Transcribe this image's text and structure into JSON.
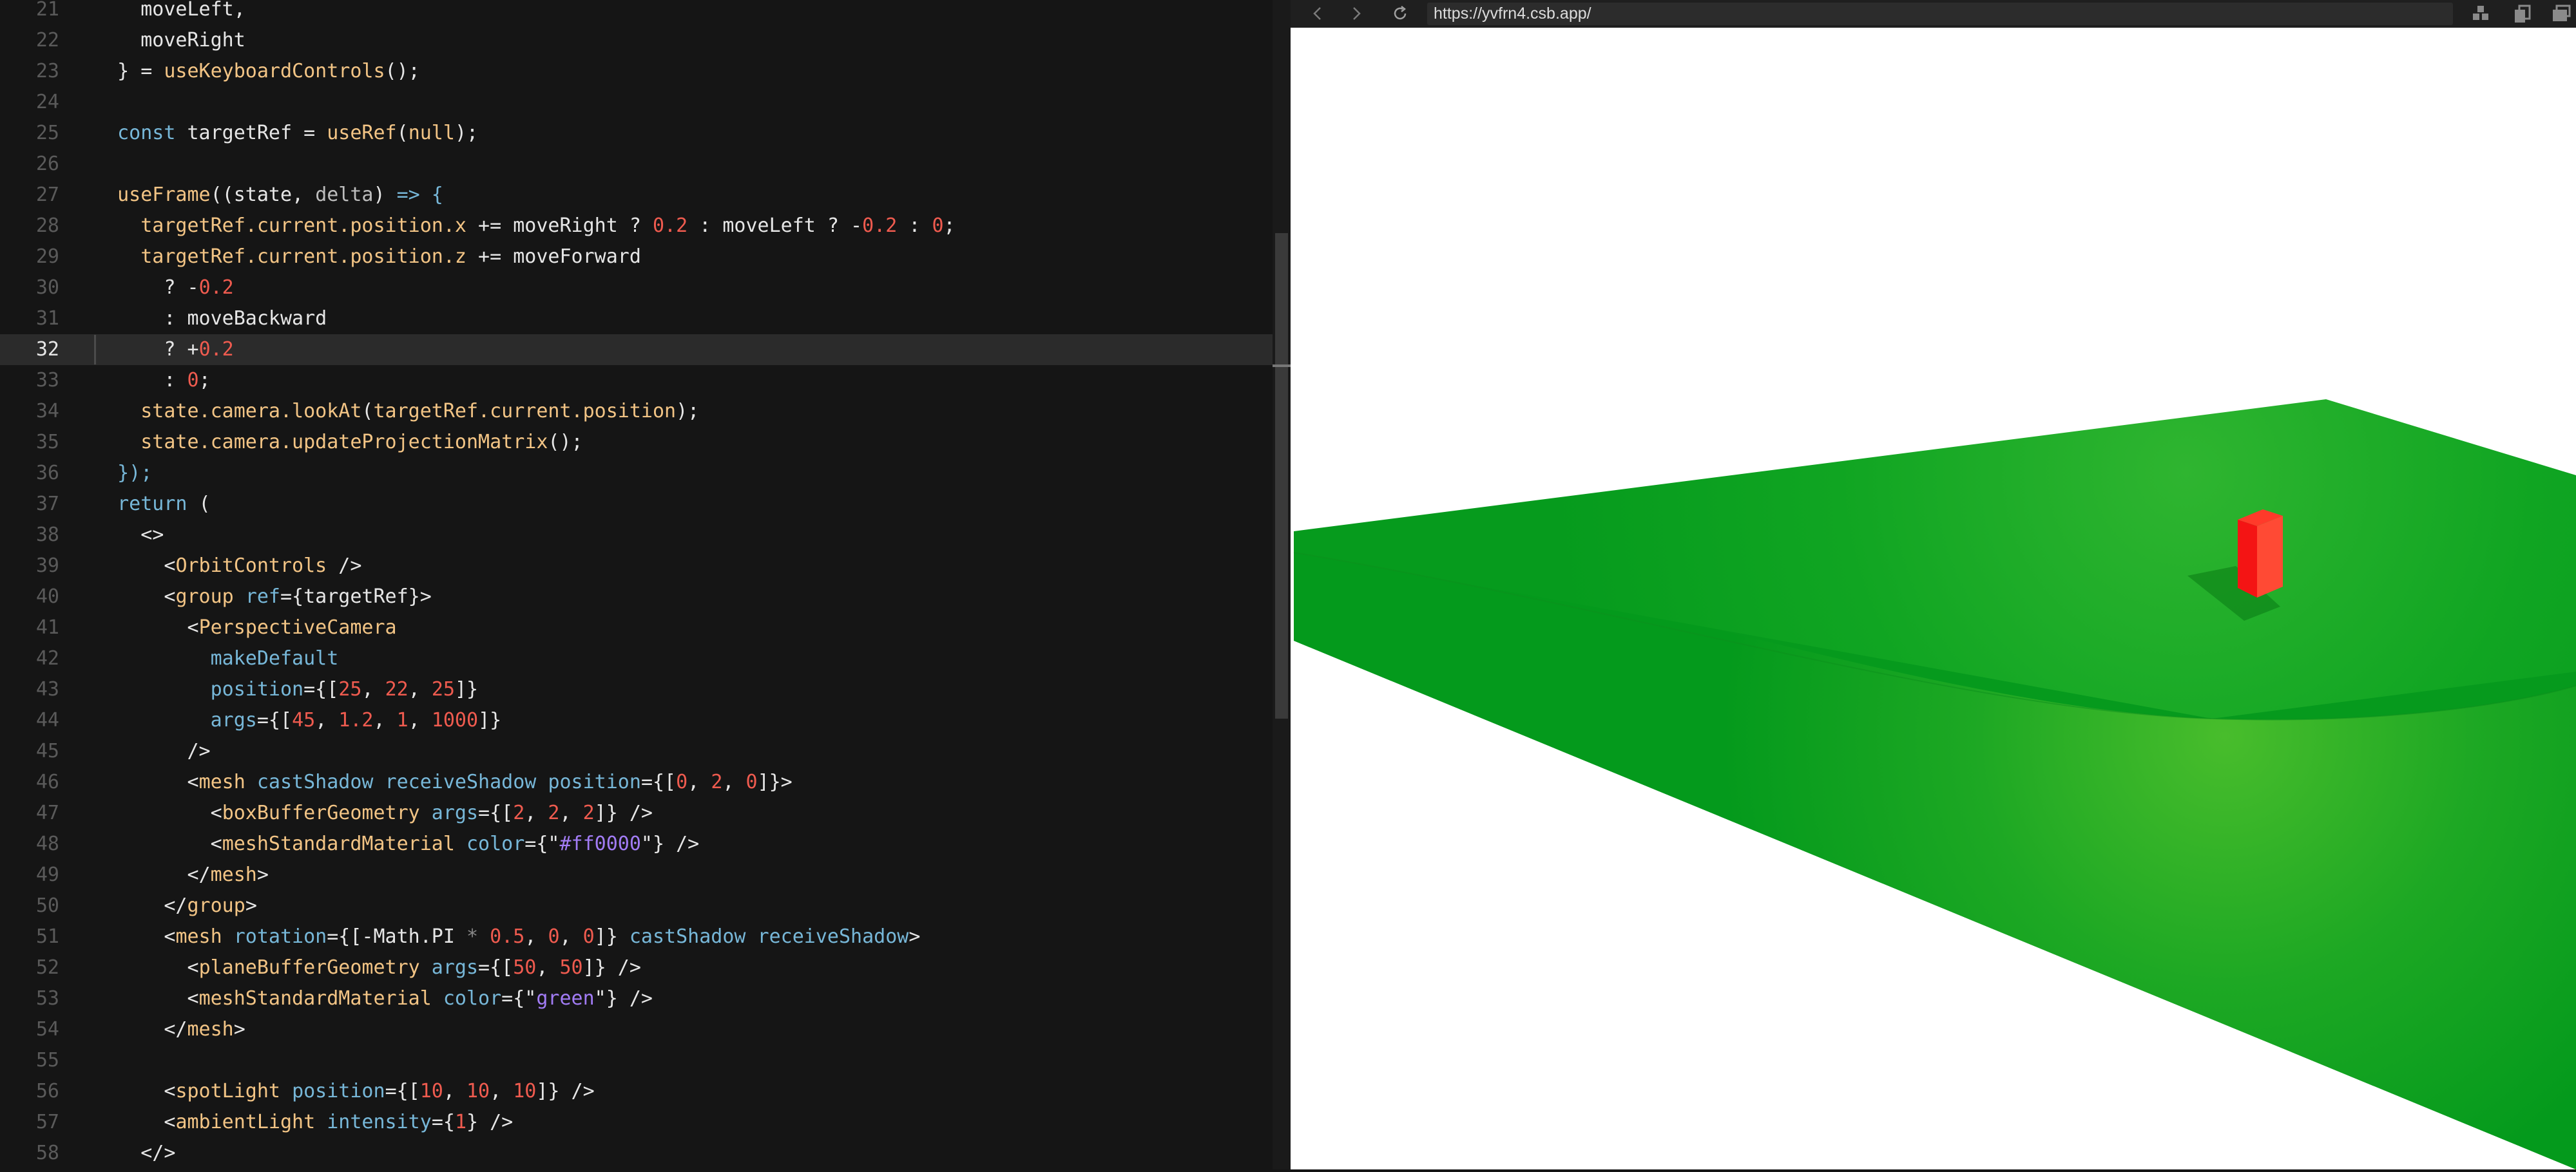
{
  "editor": {
    "current_line": 32,
    "lines": [
      {
        "num": 21,
        "tokens": [
          {
            "t": "    moveLeft,",
            "c": "default"
          }
        ]
      },
      {
        "num": 22,
        "tokens": [
          {
            "t": "    moveRight",
            "c": "default"
          }
        ]
      },
      {
        "num": 23,
        "tokens": [
          {
            "t": "  } = ",
            "c": "default"
          },
          {
            "t": "useKeyboardControls",
            "c": "function"
          },
          {
            "t": "();",
            "c": "default"
          }
        ]
      },
      {
        "num": 24,
        "tokens": []
      },
      {
        "num": 25,
        "tokens": [
          {
            "t": "  ",
            "c": "default"
          },
          {
            "t": "const",
            "c": "keyword"
          },
          {
            "t": " targetRef = ",
            "c": "default"
          },
          {
            "t": "useRef",
            "c": "function"
          },
          {
            "t": "(",
            "c": "default"
          },
          {
            "t": "null",
            "c": "function"
          },
          {
            "t": ");",
            "c": "default"
          }
        ]
      },
      {
        "num": 26,
        "tokens": []
      },
      {
        "num": 27,
        "tokens": [
          {
            "t": "  ",
            "c": "default"
          },
          {
            "t": "useFrame",
            "c": "function"
          },
          {
            "t": "((state, ",
            "c": "default"
          },
          {
            "t": "delta",
            "c": "param"
          },
          {
            "t": ") ",
            "c": "default"
          },
          {
            "t": "=> {",
            "c": "keyword"
          }
        ]
      },
      {
        "num": 28,
        "tokens": [
          {
            "t": "    ",
            "c": "default"
          },
          {
            "t": "targetRef.current.position.x",
            "c": "function"
          },
          {
            "t": " += moveRight ? ",
            "c": "default"
          },
          {
            "t": "0.2",
            "c": "number"
          },
          {
            "t": " : moveLeft ? -",
            "c": "default"
          },
          {
            "t": "0.2",
            "c": "number"
          },
          {
            "t": " : ",
            "c": "default"
          },
          {
            "t": "0",
            "c": "number"
          },
          {
            "t": ";",
            "c": "default"
          }
        ]
      },
      {
        "num": 29,
        "tokens": [
          {
            "t": "    ",
            "c": "default"
          },
          {
            "t": "targetRef.current.position.z",
            "c": "function"
          },
          {
            "t": " += moveForward",
            "c": "default"
          }
        ]
      },
      {
        "num": 30,
        "tokens": [
          {
            "t": "      ? -",
            "c": "default"
          },
          {
            "t": "0.2",
            "c": "number"
          }
        ]
      },
      {
        "num": 31,
        "tokens": [
          {
            "t": "      : moveBackward",
            "c": "default"
          }
        ]
      },
      {
        "num": 32,
        "tokens": [
          {
            "t": "      ? +",
            "c": "default"
          },
          {
            "t": "0.2",
            "c": "number"
          }
        ]
      },
      {
        "num": 33,
        "tokens": [
          {
            "t": "      : ",
            "c": "default"
          },
          {
            "t": "0",
            "c": "number"
          },
          {
            "t": ";",
            "c": "default"
          }
        ]
      },
      {
        "num": 34,
        "tokens": [
          {
            "t": "    ",
            "c": "default"
          },
          {
            "t": "state.camera.lookAt",
            "c": "function"
          },
          {
            "t": "(",
            "c": "default"
          },
          {
            "t": "targetRef.current.position",
            "c": "function"
          },
          {
            "t": ");",
            "c": "default"
          }
        ]
      },
      {
        "num": 35,
        "tokens": [
          {
            "t": "    ",
            "c": "default"
          },
          {
            "t": "state.camera.updateProjectionMatrix",
            "c": "function"
          },
          {
            "t": "();",
            "c": "default"
          }
        ]
      },
      {
        "num": 36,
        "tokens": [
          {
            "t": "  ",
            "c": "default"
          },
          {
            "t": "});",
            "c": "keyword"
          }
        ]
      },
      {
        "num": 37,
        "tokens": [
          {
            "t": "  ",
            "c": "default"
          },
          {
            "t": "return",
            "c": "keyword"
          },
          {
            "t": " (",
            "c": "default"
          }
        ]
      },
      {
        "num": 38,
        "tokens": [
          {
            "t": "    <>",
            "c": "default"
          }
        ]
      },
      {
        "num": 39,
        "tokens": [
          {
            "t": "      <",
            "c": "default"
          },
          {
            "t": "OrbitControls",
            "c": "tag"
          },
          {
            "t": " />",
            "c": "default"
          }
        ]
      },
      {
        "num": 40,
        "tokens": [
          {
            "t": "      <",
            "c": "default"
          },
          {
            "t": "group",
            "c": "tag"
          },
          {
            "t": " ",
            "c": "default"
          },
          {
            "t": "ref",
            "c": "attr"
          },
          {
            "t": "={targetRef}>",
            "c": "default"
          }
        ]
      },
      {
        "num": 41,
        "tokens": [
          {
            "t": "        <",
            "c": "default"
          },
          {
            "t": "PerspectiveCamera",
            "c": "tag"
          }
        ]
      },
      {
        "num": 42,
        "tokens": [
          {
            "t": "          ",
            "c": "default"
          },
          {
            "t": "makeDefault",
            "c": "attr"
          }
        ]
      },
      {
        "num": 43,
        "tokens": [
          {
            "t": "          ",
            "c": "default"
          },
          {
            "t": "position",
            "c": "attr"
          },
          {
            "t": "={[",
            "c": "default"
          },
          {
            "t": "25",
            "c": "number"
          },
          {
            "t": ", ",
            "c": "default"
          },
          {
            "t": "22",
            "c": "number"
          },
          {
            "t": ", ",
            "c": "default"
          },
          {
            "t": "25",
            "c": "number"
          },
          {
            "t": "]}",
            "c": "default"
          }
        ]
      },
      {
        "num": 44,
        "tokens": [
          {
            "t": "          ",
            "c": "default"
          },
          {
            "t": "args",
            "c": "attr"
          },
          {
            "t": "={[",
            "c": "default"
          },
          {
            "t": "45",
            "c": "number"
          },
          {
            "t": ", ",
            "c": "default"
          },
          {
            "t": "1.2",
            "c": "number"
          },
          {
            "t": ", ",
            "c": "default"
          },
          {
            "t": "1",
            "c": "number"
          },
          {
            "t": ", ",
            "c": "default"
          },
          {
            "t": "1000",
            "c": "number"
          },
          {
            "t": "]}",
            "c": "default"
          }
        ]
      },
      {
        "num": 45,
        "tokens": [
          {
            "t": "        />",
            "c": "default"
          }
        ]
      },
      {
        "num": 46,
        "tokens": [
          {
            "t": "        <",
            "c": "default"
          },
          {
            "t": "mesh",
            "c": "tag"
          },
          {
            "t": " ",
            "c": "default"
          },
          {
            "t": "castShadow",
            "c": "attr"
          },
          {
            "t": " ",
            "c": "default"
          },
          {
            "t": "receiveShadow",
            "c": "attr"
          },
          {
            "t": " ",
            "c": "default"
          },
          {
            "t": "position",
            "c": "attr"
          },
          {
            "t": "={[",
            "c": "default"
          },
          {
            "t": "0",
            "c": "number"
          },
          {
            "t": ", ",
            "c": "default"
          },
          {
            "t": "2",
            "c": "number"
          },
          {
            "t": ", ",
            "c": "default"
          },
          {
            "t": "0",
            "c": "number"
          },
          {
            "t": "]}>",
            "c": "default"
          }
        ]
      },
      {
        "num": 47,
        "tokens": [
          {
            "t": "          <",
            "c": "default"
          },
          {
            "t": "boxBufferGeometry",
            "c": "tag"
          },
          {
            "t": " ",
            "c": "default"
          },
          {
            "t": "args",
            "c": "attr"
          },
          {
            "t": "={[",
            "c": "default"
          },
          {
            "t": "2",
            "c": "number"
          },
          {
            "t": ", ",
            "c": "default"
          },
          {
            "t": "2",
            "c": "number"
          },
          {
            "t": ", ",
            "c": "default"
          },
          {
            "t": "2",
            "c": "number"
          },
          {
            "t": "]} />",
            "c": "default"
          }
        ]
      },
      {
        "num": 48,
        "tokens": [
          {
            "t": "          <",
            "c": "default"
          },
          {
            "t": "meshStandardMaterial",
            "c": "tag"
          },
          {
            "t": " ",
            "c": "default"
          },
          {
            "t": "color",
            "c": "attr"
          },
          {
            "t": "={\"",
            "c": "default"
          },
          {
            "t": "#ff0000",
            "c": "string"
          },
          {
            "t": "\"} />",
            "c": "default"
          }
        ]
      },
      {
        "num": 49,
        "tokens": [
          {
            "t": "        </",
            "c": "default"
          },
          {
            "t": "mesh",
            "c": "tag"
          },
          {
            "t": ">",
            "c": "default"
          }
        ]
      },
      {
        "num": 50,
        "tokens": [
          {
            "t": "      </",
            "c": "default"
          },
          {
            "t": "group",
            "c": "tag"
          },
          {
            "t": ">",
            "c": "default"
          }
        ]
      },
      {
        "num": 51,
        "tokens": [
          {
            "t": "      <",
            "c": "default"
          },
          {
            "t": "mesh",
            "c": "tag"
          },
          {
            "t": " ",
            "c": "default"
          },
          {
            "t": "rotation",
            "c": "attr"
          },
          {
            "t": "={[-",
            "c": "default"
          },
          {
            "t": "Math.PI",
            "c": "default"
          },
          {
            "t": " * ",
            "c": "muted"
          },
          {
            "t": "0.5",
            "c": "number"
          },
          {
            "t": ", ",
            "c": "default"
          },
          {
            "t": "0",
            "c": "number"
          },
          {
            "t": ", ",
            "c": "default"
          },
          {
            "t": "0",
            "c": "number"
          },
          {
            "t": "]} ",
            "c": "default"
          },
          {
            "t": "castShadow",
            "c": "attr"
          },
          {
            "t": " ",
            "c": "default"
          },
          {
            "t": "receiveShadow",
            "c": "attr"
          },
          {
            "t": ">",
            "c": "default"
          }
        ]
      },
      {
        "num": 52,
        "tokens": [
          {
            "t": "        <",
            "c": "default"
          },
          {
            "t": "planeBufferGeometry",
            "c": "tag"
          },
          {
            "t": " ",
            "c": "default"
          },
          {
            "t": "args",
            "c": "attr"
          },
          {
            "t": "={[",
            "c": "default"
          },
          {
            "t": "50",
            "c": "number"
          },
          {
            "t": ", ",
            "c": "default"
          },
          {
            "t": "50",
            "c": "number"
          },
          {
            "t": "]} />",
            "c": "default"
          }
        ]
      },
      {
        "num": 53,
        "tokens": [
          {
            "t": "        <",
            "c": "default"
          },
          {
            "t": "meshStandardMaterial",
            "c": "tag"
          },
          {
            "t": " ",
            "c": "default"
          },
          {
            "t": "color",
            "c": "attr"
          },
          {
            "t": "={\"",
            "c": "default"
          },
          {
            "t": "green",
            "c": "string"
          },
          {
            "t": "\"} />",
            "c": "default"
          }
        ]
      },
      {
        "num": 54,
        "tokens": [
          {
            "t": "      </",
            "c": "default"
          },
          {
            "t": "mesh",
            "c": "tag"
          },
          {
            "t": ">",
            "c": "default"
          }
        ]
      },
      {
        "num": 55,
        "tokens": []
      },
      {
        "num": 56,
        "tokens": [
          {
            "t": "      <",
            "c": "default"
          },
          {
            "t": "spotLight",
            "c": "tag"
          },
          {
            "t": " ",
            "c": "default"
          },
          {
            "t": "position",
            "c": "attr"
          },
          {
            "t": "={[",
            "c": "default"
          },
          {
            "t": "10",
            "c": "number"
          },
          {
            "t": ", ",
            "c": "default"
          },
          {
            "t": "10",
            "c": "number"
          },
          {
            "t": ", ",
            "c": "default"
          },
          {
            "t": "10",
            "c": "number"
          },
          {
            "t": "]} />",
            "c": "default"
          }
        ]
      },
      {
        "num": 57,
        "tokens": [
          {
            "t": "      <",
            "c": "default"
          },
          {
            "t": "ambientLight",
            "c": "tag"
          },
          {
            "t": " ",
            "c": "default"
          },
          {
            "t": "intensity",
            "c": "attr"
          },
          {
            "t": "={",
            "c": "default"
          },
          {
            "t": "1",
            "c": "number"
          },
          {
            "t": "} />",
            "c": "default"
          }
        ]
      },
      {
        "num": 58,
        "tokens": [
          {
            "t": "    </>",
            "c": "default"
          }
        ]
      }
    ]
  },
  "browser": {
    "url": "https://yvfrn4.csb.app/",
    "back_icon": "chevron-left-icon",
    "forward_icon": "chevron-right-icon",
    "refresh_icon": "refresh-icon"
  },
  "scene": {
    "ground_color": "#07a01f",
    "box_color": "#ff0000",
    "background_color": "#ffffff"
  }
}
